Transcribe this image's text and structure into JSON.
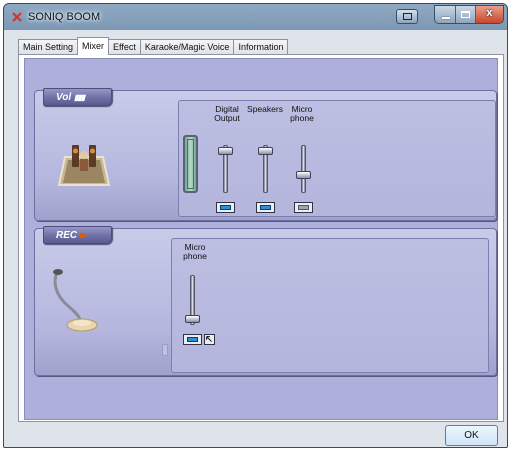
{
  "window": {
    "title": "SONIQ BOOM",
    "accent_color": "#aeb0dc",
    "caption_buttons": [
      "minimize",
      "maximize",
      "close"
    ],
    "close_glyph": "x"
  },
  "tabs": [
    {
      "label": "Main Setting",
      "active": false
    },
    {
      "label": "Mixer",
      "active": true
    },
    {
      "label": "Effect",
      "active": false
    },
    {
      "label": "Karaoke/Magic Voice",
      "active": false
    },
    {
      "label": "Information",
      "active": false
    }
  ],
  "mixer": {
    "volume_section": {
      "label": "Vol",
      "label_suffix": "▮▮▮",
      "icon": "speaker-stage-icon",
      "level_meter": "vu-meter",
      "channels": [
        {
          "name_line1": "Digital",
          "name_line2": "Output",
          "level": 0.95,
          "muted": false
        },
        {
          "name_line1": "Speakers",
          "name_line2": "",
          "level": 0.95,
          "muted": false
        },
        {
          "name_line1": "Micro",
          "name_line2": "phone",
          "level": 0.35,
          "muted": true
        }
      ]
    },
    "record_section": {
      "label": "REC",
      "icon": "microphone-icon",
      "channels": [
        {
          "name_line1": "Micro",
          "name_line2": "phone",
          "level": 0.05,
          "selected": true
        }
      ]
    }
  },
  "footer": {
    "ok_label": "OK"
  }
}
